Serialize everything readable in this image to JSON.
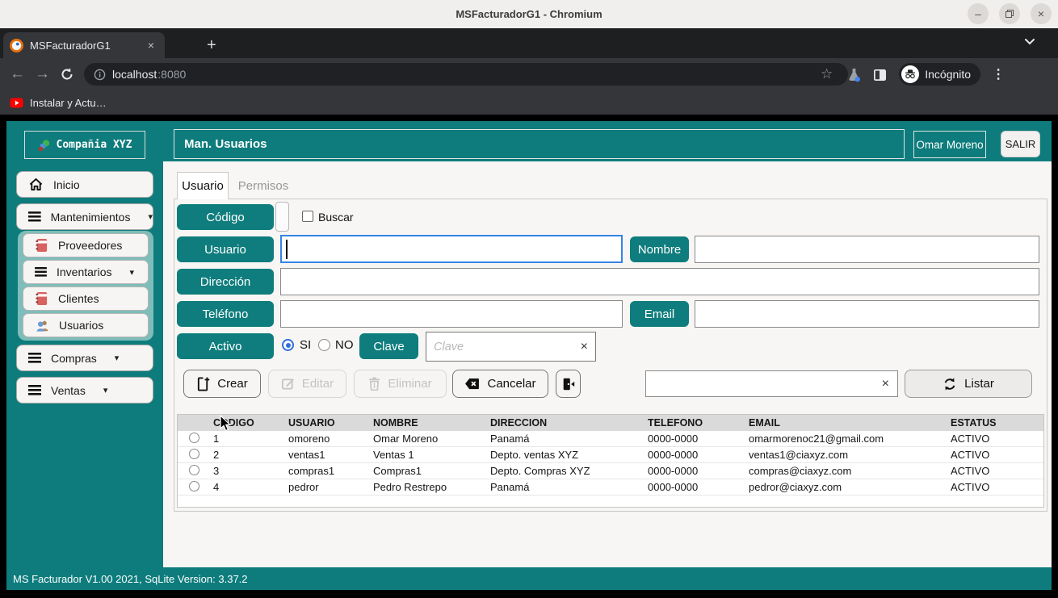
{
  "window": {
    "title": "MSFacturadorG1 - Chromium",
    "minimize_glyph": "–",
    "close_glyph": "×"
  },
  "browser": {
    "tab_title": "MSFacturadorG1",
    "tab_close_glyph": "×",
    "new_tab_glyph": "+",
    "back_glyph": "←",
    "forward_glyph": "→",
    "url_host": "localhost",
    "url_port": ":8080",
    "star_glyph": "☆",
    "incognito_label": "Incógnito",
    "menu_dots_glyph": "⋮",
    "bookmark_label": "Instalar y Actu…"
  },
  "theme": {
    "teal": "#0e7c7c",
    "light_teal": "#7fbdba",
    "focus_blue": "#3584e4",
    "radio_blue": "#2f6fde",
    "panel_bg": "#f7f6f4",
    "table_header_bg": "#dadada"
  },
  "app": {
    "company": "Compañia XYZ",
    "page_title": "Man. Usuarios",
    "user_button": "Omar Moreno",
    "logout_button": "SALIR",
    "sidebar": {
      "inicio": "Inicio",
      "mantenimientos": "Mantenimientos",
      "sub": [
        "Proveedores",
        "Inventarios",
        "Clientes",
        "Usuarios"
      ],
      "compras": "Compras",
      "ventas": "Ventas",
      "caret_glyph": "▾"
    },
    "tabs": {
      "usuario": "Usuario",
      "permisos": "Permisos"
    },
    "form": {
      "codigo_label": "Código",
      "buscar_label": "Buscar",
      "usuario_label": "Usuario",
      "nombre_label": "Nombre",
      "direccion_label": "Dirección",
      "telefono_label": "Teléfono",
      "email_label": "Email",
      "activo_label": "Activo",
      "si_label": "SI",
      "no_label": "NO",
      "activo_selected": "SI",
      "clave_label": "Clave",
      "clave_placeholder": "Clave",
      "clear_glyph": "×"
    },
    "actions": {
      "crear": "Crear",
      "editar": "Editar",
      "eliminar": "Eliminar",
      "cancelar": "Cancelar",
      "listar": "Listar",
      "search_clear_glyph": "×"
    },
    "table": {
      "headers": [
        "CODIGO",
        "USUARIO",
        "NOMBRE",
        "DIRECCION",
        "TELEFONO",
        "EMAIL",
        "ESTATUS"
      ],
      "rows": [
        {
          "codigo": "1",
          "usuario": "omoreno",
          "nombre": "Omar Moreno",
          "direccion": "Panamá",
          "telefono": "0000-0000",
          "email": "omarmorenoc21@gmail.com",
          "estatus": "ACTIVO"
        },
        {
          "codigo": "2",
          "usuario": "ventas1",
          "nombre": "Ventas 1",
          "direccion": "Depto. ventas XYZ",
          "telefono": "0000-0000",
          "email": "ventas1@ciaxyz.com",
          "estatus": "ACTIVO"
        },
        {
          "codigo": "3",
          "usuario": "compras1",
          "nombre": "Compras1",
          "direccion": "Depto. Compras XYZ",
          "telefono": "0000-0000",
          "email": "compras@ciaxyz.com",
          "estatus": "ACTIVO"
        },
        {
          "codigo": "4",
          "usuario": "pedror",
          "nombre": "Pedro Restrepo",
          "direccion": "Panamá",
          "telefono": "0000-0000",
          "email": "pedror@ciaxyz.com",
          "estatus": "ACTIVO"
        }
      ]
    },
    "footer": "MS Facturador V1.00 2021, SqLite Version: 3.37.2"
  }
}
